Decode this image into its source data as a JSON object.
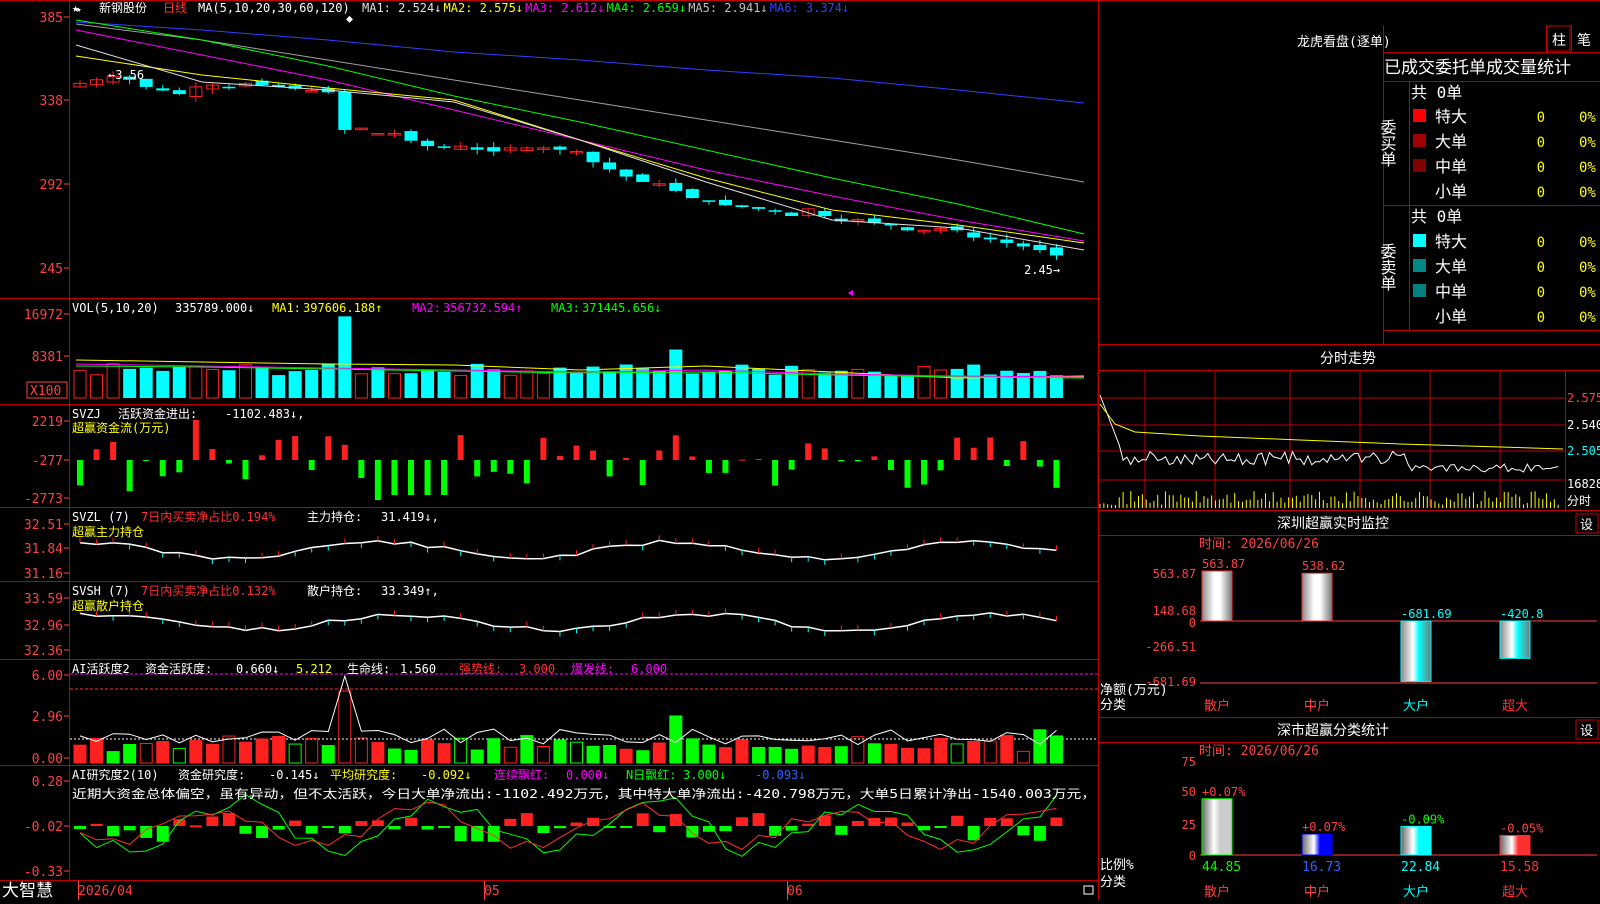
{
  "colors": {
    "up": "#ff2020",
    "down": "#00ffff",
    "ma1": "#e0e0e0",
    "ma2": "#ffff00",
    "ma3": "#ff00ff",
    "ma4": "#00ff00",
    "ma5": "#a0a0a0",
    "ma6": "#3040ff",
    "grid": "#c00000",
    "label": "#ff4040"
  },
  "header": {
    "star": "★",
    "name": "新钢股份",
    "period": "日线",
    "ma_text": "MA(5,10,20,30,60,120)",
    "ma": [
      {
        "k": "MA1:",
        "v": "2.524↓",
        "c": "#e0e0e0"
      },
      {
        "k": "MA2:",
        "v": "2.575↓",
        "c": "#ffff00"
      },
      {
        "k": "MA3:",
        "v": "2.612↓",
        "c": "#ff00ff"
      },
      {
        "k": "MA4:",
        "v": "2.659↓",
        "c": "#00ff00"
      },
      {
        "k": "MA5:",
        "v": "2.941↓",
        "c": "#c0c0c0"
      },
      {
        "k": "MA6:",
        "v": "3.374↓",
        "c": "#3040ff"
      }
    ]
  },
  "price_axis": [
    "385",
    "338",
    "292",
    "245"
  ],
  "annot": {
    "high": "3.56",
    "low": "2.45"
  },
  "vol": {
    "title": "VOL(5,10,20)",
    "value": "335789.000↓",
    "ma": [
      {
        "t": "MA1:",
        "v": "397606.188↑",
        "c": "#ffff00"
      },
      {
        "t": "MA2:",
        "v": "356732.594↑",
        "c": "#ff00ff"
      },
      {
        "t": "MA3:",
        "v": "371445.656↓",
        "c": "#00ff00"
      }
    ],
    "axis": [
      "16972",
      "8381",
      "X100"
    ]
  },
  "svzj": {
    "t1": "SVZJ",
    "t2": "活跃资金进出:",
    "v": "-1102.483↓,",
    "sub": "超赢资金流(万元)",
    "axis": [
      "2219",
      "-277",
      "-2773"
    ]
  },
  "svzl": {
    "t1": "SVZL (7)",
    "t2": "7日内买卖净占比0.194%",
    "t3": "主力持仓:",
    "v": "31.419↓,",
    "sub": "超赢主力持仓",
    "axis": [
      "32.51",
      "31.84",
      "31.16"
    ]
  },
  "svsh": {
    "t1": "SVSH (7)",
    "t2": "7日内买卖净占比0.132%",
    "t3": "散户持仓:",
    "v": "33.349↑,",
    "sub": "超赢散户持仓",
    "axis": [
      "33.59",
      "32.96",
      "32.36"
    ]
  },
  "ai1": {
    "t1": "AI活跃度2",
    "t2": "资金活跃度:",
    "v1": "0.660↓",
    "v2": "5.212",
    "t3": "生命线:",
    "v3": "1.560",
    "t4": "强势线:",
    "v4": "3.000",
    "t5": "爆发线:",
    "v5": "6.000",
    "axis": [
      "6.00",
      "2.96",
      "0.00"
    ]
  },
  "ai2": {
    "t1": "AI研究度2(10)",
    "t2": "资金研究度:",
    "v1": "-0.145↓",
    "t3": "平均研究度:",
    "v2": "-0.092↓",
    "t4": "连续飘红:",
    "v3": "0.000↓",
    "t5": "N日飘红:",
    "v4": "3.000↓",
    "v5": "-0.093↓",
    "desc": "近期大资金总体偏空，虽有异动，但不太活跃，今日大单净流出:-1102.492万元，其中特大单净流出:-420.798万元，大单5日累计净出-1540.003万元，",
    "axis": [
      "0.28",
      "-0.02",
      "-0.33"
    ]
  },
  "date_axis": [
    "2026/04",
    "05",
    "06"
  ],
  "brand": "大智慧",
  "dragon": {
    "title": "龙虎看盘(逐单)",
    "tab1": "柱",
    "tab2": "笔",
    "header": "已成交委托单成交量统计",
    "buy": {
      "label": "委买单",
      "total": "共 0单",
      "rows": [
        {
          "n": "特大",
          "v": "0",
          "p": "0%"
        },
        {
          "n": "大单",
          "v": "0",
          "p": "0%"
        },
        {
          "n": "中单",
          "v": "0",
          "p": "0%"
        },
        {
          "n": "小单",
          "v": "0",
          "p": "0%"
        }
      ]
    },
    "sell": {
      "label": "委卖单",
      "total": "共 0单",
      "rows": [
        {
          "n": "特大",
          "v": "0",
          "p": "0%"
        },
        {
          "n": "大单",
          "v": "0",
          "p": "0%"
        },
        {
          "n": "中单",
          "v": "0",
          "p": "0%"
        },
        {
          "n": "小单",
          "v": "0",
          "p": "0%"
        }
      ]
    }
  },
  "intraday": {
    "title": "分时走势",
    "axis": [
      "2.575",
      "2.540",
      "2.505",
      "16828",
      "分时"
    ]
  },
  "sz_monitor": {
    "title": "深圳超赢实时监控",
    "set": "设",
    "time": "时间: 2026/06/26",
    "axis": [
      "563.87",
      "148.68",
      "0",
      "-266.51",
      "-681.69"
    ],
    "ylabel": "净额(万元)",
    "xlabel": "分类",
    "bars": [
      {
        "n": "散户",
        "v": "563.87",
        "val": 563.87
      },
      {
        "n": "中户",
        "v": "538.62",
        "val": 538.62
      },
      {
        "n": "大户",
        "v": "-681.69",
        "val": -681.69
      },
      {
        "n": "超大",
        "v": "-420.8",
        "val": -420.8
      }
    ]
  },
  "sz_class": {
    "title": "深市超赢分类统计",
    "set": "设",
    "time": "时间: 2026/06/26",
    "axis": [
      "75",
      "50",
      "25",
      "0"
    ],
    "ylabel": "比例%",
    "xlabel": "分类",
    "bars": [
      {
        "n": "散户",
        "top": "+0.07%",
        "bot": "44.85",
        "val": 44.85
      },
      {
        "n": "中户",
        "top": "+0.07%",
        "bot": "16.73",
        "val": 16.73
      },
      {
        "n": "大户",
        "top": "-0.09%",
        "bot": "22.84",
        "val": 22.84
      },
      {
        "n": "超大",
        "top": "-0.05%",
        "bot": "15.58",
        "val": 15.58
      }
    ]
  }
}
